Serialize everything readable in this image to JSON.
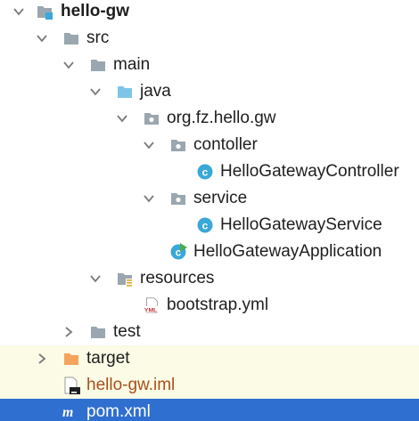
{
  "project_tree": {
    "root": {
      "label": "hello-gw"
    },
    "src": {
      "label": "src"
    },
    "main": {
      "label": "main"
    },
    "java": {
      "label": "java"
    },
    "package": {
      "label": "org.fz.hello.gw"
    },
    "contoller": {
      "label": "contoller"
    },
    "controller_class": {
      "label": "HelloGatewayController"
    },
    "service": {
      "label": "service"
    },
    "service_class": {
      "label": "HelloGatewayService"
    },
    "application_class": {
      "label": "HelloGatewayApplication"
    },
    "resources": {
      "label": "resources"
    },
    "bootstrap": {
      "label": "bootstrap.yml",
      "badge": "YML"
    },
    "test": {
      "label": "test"
    },
    "target": {
      "label": "target"
    },
    "iml": {
      "label": "hello-gw.iml"
    },
    "pom": {
      "label": "pom.xml",
      "badge": "m"
    }
  },
  "colors": {
    "folder_gray": "#9aa7b0",
    "folder_blue": "#7ec4e8",
    "folder_orange": "#f4a45c",
    "class_circle": "#3aa8d8",
    "selection": "#2f6fd0",
    "excluded_bg": "#fbfbe6",
    "excluded_text": "#a8501c",
    "yml_red": "#c8323a"
  },
  "icons": {
    "root": "module-folder-icon",
    "folder": "folder-icon",
    "source_root": "source-folder-icon",
    "package": "package-icon",
    "class": "class-icon",
    "spring_boot_class": "spring-boot-class-icon",
    "resources_root": "resources-folder-icon",
    "yml_file": "yml-file-icon",
    "excluded_folder": "excluded-folder-icon",
    "iml_file": "iml-file-icon",
    "maven_file": "maven-file-icon",
    "expanded": "chevron-down-icon",
    "collapsed": "chevron-right-icon"
  }
}
